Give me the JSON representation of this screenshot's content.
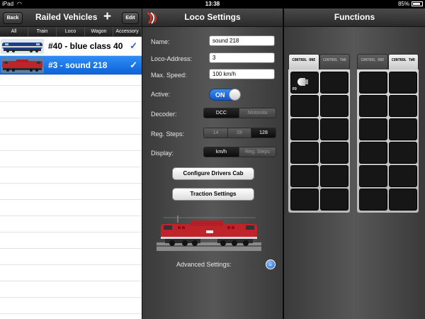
{
  "status": {
    "device": "iPad",
    "time": "13:38",
    "battery": "85%",
    "battery_level": 0.85
  },
  "left": {
    "back": "Back",
    "title": "Railed Vehicles",
    "add": "+",
    "edit": "Edit",
    "filters": [
      {
        "label": "All",
        "selected": true
      },
      {
        "label": "Train",
        "selected": false
      },
      {
        "label": "Loco",
        "selected": false
      },
      {
        "label": "Wagon",
        "selected": false
      },
      {
        "label": "Accessory",
        "selected": false
      }
    ],
    "vehicles": [
      {
        "name": "#40 - blue class 40",
        "checked": true,
        "selected": false
      },
      {
        "name": "#3 - sound 218",
        "checked": true,
        "selected": true
      }
    ]
  },
  "loco": {
    "title": "Loco Settings",
    "name_label": "Name:",
    "name_value": "sound 218",
    "address_label": "Loco-Address:",
    "address_value": "3",
    "speed_label": "Max. Speed:",
    "speed_value": "100 km/h",
    "active_label": "Active:",
    "active_value": "ON",
    "decoder_label": "Decoder:",
    "decoder_options": [
      "DCC",
      "Motorola"
    ],
    "decoder_selected": "DCC",
    "steps_label": "Reg. Steps:",
    "steps_options": [
      "14",
      "28",
      "128"
    ],
    "steps_selected": "128",
    "display_label": "Display:",
    "display_options": [
      "km/h",
      "Reg. Steps"
    ],
    "display_selected": "km/h",
    "configure_button": "Configure Drivers Cab",
    "traction_button": "Traction Settings",
    "advanced_label": "Advanced Settings:"
  },
  "functions": {
    "title": "Functions",
    "group1_tabs": [
      "CONTROL ONE",
      "CONTROL TWO"
    ],
    "group1_active": 0,
    "group2_tabs": [
      "CONTROL ONE",
      "CONTROL TWO"
    ],
    "group2_active": 1,
    "f0_label": "F0",
    "colors": {
      "accent": "#1a6de0",
      "panel": "#4a4a4a",
      "button": "#161616"
    }
  }
}
